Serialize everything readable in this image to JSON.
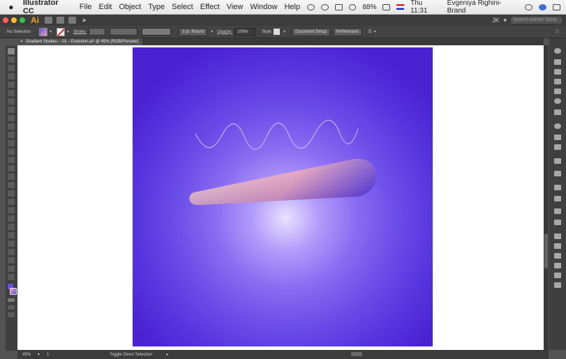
{
  "menubar": {
    "app_name": "Illustrator CC",
    "items": [
      "File",
      "Edit",
      "Object",
      "Type",
      "Select",
      "Effect",
      "View",
      "Window",
      "Help"
    ],
    "battery": "88%",
    "clock": "Thu 11:31",
    "user": "Evgeniya Righini-Brand"
  },
  "appbar": {
    "logo": "Ai",
    "workspace": "JK",
    "search_placeholder": "Search Adobe Stock"
  },
  "controlbar": {
    "selection_label": "No Selection",
    "stroke_label": "Stroke:",
    "brush_label": "3 pt. Round",
    "opacity_label": "Opacity:",
    "opacity_value": "100%",
    "style_label": "Style:",
    "document_setup": "Document Setup",
    "preferences": "Preferences"
  },
  "document_tab": {
    "label": "Gradient Studies – 03 – Evolution.ai* @ 45% (RGB/Preview)"
  },
  "statusbar": {
    "zoom": "45%",
    "page": "1",
    "selection_info": "Toggle Direct Selection"
  },
  "artwork": {
    "background_gradient": [
      "#e8e2ff",
      "#8a6cf2",
      "#4a22d2"
    ],
    "tusk_gradient": [
      "#f9d2cc",
      "#e9a1b9",
      "#5535cf"
    ],
    "wave_color": "#d6c9fb"
  },
  "icons": {
    "apple": "apple-logo-icon",
    "search": "search-icon",
    "close_tab": "close-tab-icon"
  }
}
